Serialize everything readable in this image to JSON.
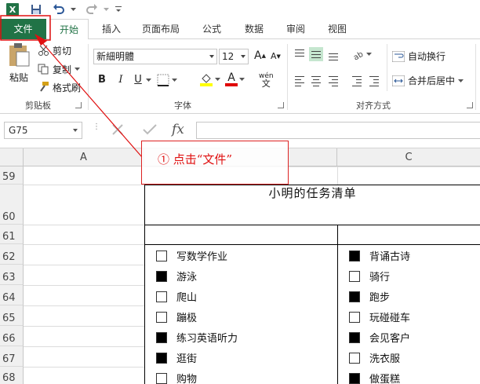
{
  "app": {
    "logo_letter": "X"
  },
  "qat": {
    "save_icon": "save-icon",
    "undo_icon": "undo-icon",
    "redo_icon": "redo-icon"
  },
  "tabs": [
    {
      "label": "文件"
    },
    {
      "label": "开始"
    },
    {
      "label": "插入"
    },
    {
      "label": "页面布局"
    },
    {
      "label": "公式"
    },
    {
      "label": "数据"
    },
    {
      "label": "审阅"
    },
    {
      "label": "视图"
    }
  ],
  "ribbon": {
    "clipboard": {
      "paste": "粘贴",
      "cut": "剪切",
      "copy": "复制",
      "painter": "格式刷",
      "label": "剪贴板"
    },
    "font": {
      "name": "新細明體",
      "size": "12",
      "grow": "A",
      "shrink": "A",
      "bold": "B",
      "italic": "I",
      "underline": "U",
      "font_color_letter": "A",
      "phonetic": "wén",
      "label": "字体"
    },
    "alignment": {
      "wrap": "自动换行",
      "merge": "合并后居中",
      "label": "对齐方式"
    }
  },
  "formula_bar": {
    "name_box": "G75",
    "fx": "fx"
  },
  "grid": {
    "columns": [
      "A",
      "C"
    ],
    "rows": [
      "59",
      "60",
      "61",
      "62",
      "63",
      "64",
      "65",
      "66",
      "67",
      "68"
    ],
    "title": "小明的任务清单",
    "left_tasks": [
      {
        "text": "写数学作业",
        "checked": false
      },
      {
        "text": "游泳",
        "checked": true
      },
      {
        "text": "爬山",
        "checked": false
      },
      {
        "text": "蹦极",
        "checked": false
      },
      {
        "text": "练习英语听力",
        "checked": true
      },
      {
        "text": "逛街",
        "checked": true
      },
      {
        "text": "购物",
        "checked": false
      }
    ],
    "right_tasks": [
      {
        "text": "背诵古诗",
        "checked": true
      },
      {
        "text": "骑行",
        "checked": false
      },
      {
        "text": "跑步",
        "checked": true
      },
      {
        "text": "玩碰碰车",
        "checked": false
      },
      {
        "text": "会见客户",
        "checked": true
      },
      {
        "text": "洗衣服",
        "checked": false
      },
      {
        "text": "做蛋糕",
        "checked": true
      }
    ]
  },
  "annotation": {
    "text": "① 点击“文件”",
    "color": "#e01010"
  },
  "colors": {
    "excel_green": "#217346"
  }
}
